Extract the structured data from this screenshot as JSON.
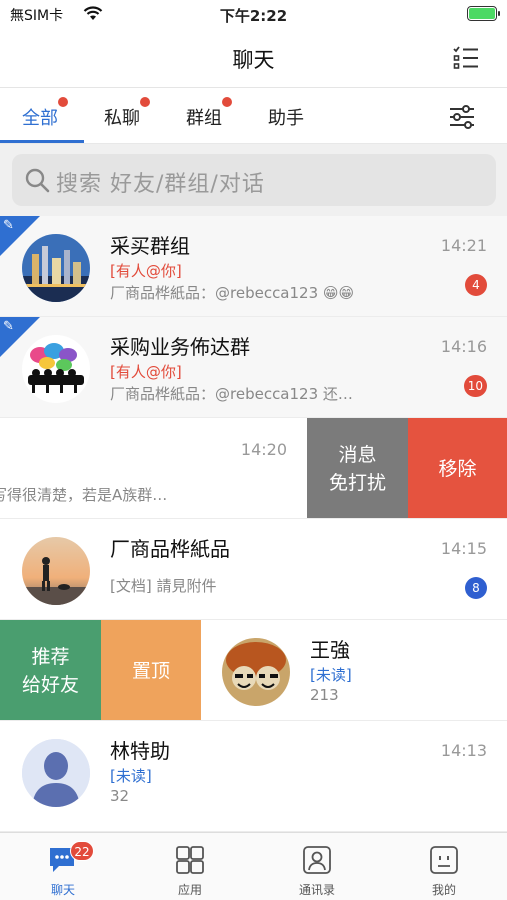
{
  "status_bar": {
    "carrier": "無SIM卡",
    "time": "下午2:22"
  },
  "nav": {
    "title": "聊天"
  },
  "tabs": [
    {
      "label": "全部",
      "dot": true,
      "active": true
    },
    {
      "label": "私聊",
      "dot": true
    },
    {
      "label": "群组",
      "dot": true
    },
    {
      "label": "助手",
      "dot": false
    }
  ],
  "search": {
    "placeholder": "搜索 好友/群组/对话"
  },
  "chats": [
    {
      "name": "采买群组",
      "time": "14:21",
      "mention": "[有人@你]",
      "preview": "厂商品桦紙品：@rebecca123 😁😁",
      "badge": "4",
      "pinned": true
    },
    {
      "name": "采购业务佈达群",
      "time": "14:16",
      "mention": "[有人@你]",
      "preview": "厂商品桦紙品：@rebecca123 还…",
      "badge": "10",
      "pinned": true
    },
    {
      "time": "14:20",
      "preview": "写得很清楚，若是A族群…",
      "actions": [
        "消息\n免打扰",
        "移除"
      ]
    },
    {
      "name": "厂商品桦紙品",
      "time": "14:15",
      "preview": "[文档] 請見附件",
      "badge": "8"
    },
    {
      "name": "王強",
      "unread_tag": "[未读]",
      "preview": "213",
      "actions": [
        "推荐\n给好友",
        "置顶"
      ]
    },
    {
      "name": "林特助",
      "time": "14:13",
      "unread_tag": "[未读]",
      "preview": "32"
    }
  ],
  "tabbar": [
    {
      "label": "聊天",
      "badge": "22",
      "active": true
    },
    {
      "label": "应用"
    },
    {
      "label": "通讯录"
    },
    {
      "label": "我的"
    }
  ],
  "colors": {
    "accent": "#2f6fd1",
    "red": "#e24b3b",
    "mute_gray": "#7b7b7b",
    "remove_red": "#e5533f",
    "recommend_green": "#4a9e6f",
    "pin_orange": "#efa35c"
  }
}
